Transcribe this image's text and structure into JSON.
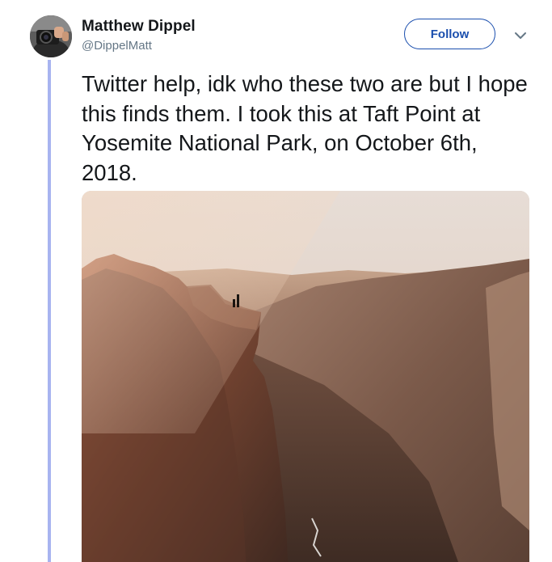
{
  "user": {
    "display_name": "Matthew Dippel",
    "handle": "@DippelMatt",
    "avatar_icon": "camera-photographer-avatar"
  },
  "actions": {
    "follow_label": "Follow",
    "menu_icon": "chevron-down-icon"
  },
  "tweet": {
    "text": "Twitter help, idk who these two are but I hope this finds them. I took this at Taft Point at Yosemite National Park, on October 6th, 2018."
  },
  "colors": {
    "accent": "#1b4fae",
    "thread_line": "#a8b4f0",
    "text": "#14171a",
    "secondary_text": "#657786"
  }
}
